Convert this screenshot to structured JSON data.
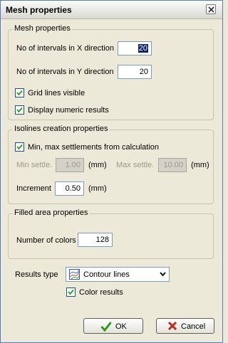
{
  "window": {
    "title": "Mesh properties"
  },
  "mesh_group": {
    "title": "Mesh properties",
    "x_intervals_label": "No of intervals in X direction",
    "x_intervals_value": "20",
    "y_intervals_label": "No of intervals in Y direction",
    "y_intervals_value": "20",
    "grid_lines_label": "Grid lines visible",
    "grid_lines_checked": true,
    "numeric_results_label": "Display numeric results",
    "numeric_results_checked": true
  },
  "isolines_group": {
    "title": "Isolines creation properties",
    "minmax_label": "Min, max settlements from calculation",
    "minmax_checked": true,
    "min_settle_label": "Min settle.",
    "min_settle_value": "1.00",
    "min_settle_unit": "(mm)",
    "max_settle_label": "Max settle.",
    "max_settle_value": "10.00",
    "max_settle_unit": "(mm)",
    "increment_label": "Increment",
    "increment_value": "0.50",
    "increment_unit": "(mm)"
  },
  "filled_group": {
    "title": "Filled area properties",
    "colors_label": "Number of colors",
    "colors_value": "128"
  },
  "results": {
    "type_label": "Results type",
    "type_value": "Contour lines",
    "color_results_label": "Color results",
    "color_results_checked": true
  },
  "buttons": {
    "ok_label": "OK",
    "cancel_label": "Cancel"
  },
  "icons": {
    "close": "close-icon",
    "check": "checkmark-icon",
    "contour": "contour-lines-icon",
    "dropdown": "chevron-down-icon",
    "ok": "green-check-icon",
    "cancel": "red-x-icon"
  },
  "colors": {
    "ok_icon": "#2e9a1e",
    "cancel_icon": "#c0281c",
    "selection": "#0a246a"
  }
}
